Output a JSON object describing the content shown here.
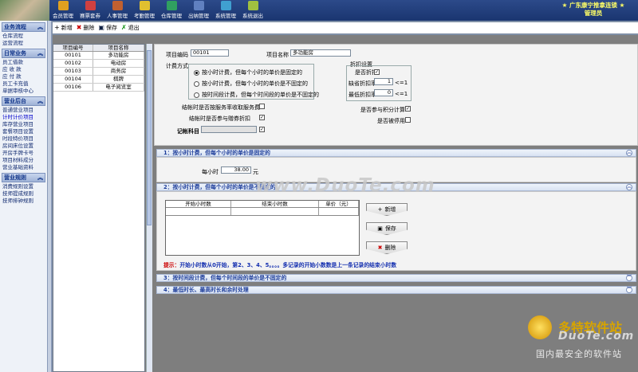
{
  "header": {
    "menu": [
      {
        "label": "会员管理",
        "icon": "member-icon",
        "color": "#e0a020"
      },
      {
        "label": "赛票套券",
        "icon": "ticket-icon",
        "color": "#d04040"
      },
      {
        "label": "人事管理",
        "icon": "person-icon",
        "color": "#c06030"
      },
      {
        "label": "考勤管理",
        "icon": "clock-icon",
        "color": "#e0c030"
      },
      {
        "label": "仓库管理",
        "icon": "warehouse-icon",
        "color": "#30a060"
      },
      {
        "label": "出纳管理",
        "icon": "cashier-icon",
        "color": "#6080c0"
      },
      {
        "label": "系统管理",
        "icon": "system-icon",
        "color": "#40a0d0"
      },
      {
        "label": "系统退出",
        "icon": "exit-icon",
        "color": "#a0c040"
      }
    ],
    "company_line1": "★ 广东康宁推拿连锁 ★",
    "company_line2": "管理员"
  },
  "sidebar": {
    "sections": [
      {
        "title": "业务流程",
        "items": [
          "仓库流程",
          "运营流程"
        ]
      },
      {
        "title": "日常业务",
        "items": [
          "员工借款",
          "应 收 款",
          "应 付 款",
          "员工卡充值",
          "单据审核中心"
        ]
      },
      {
        "title": "营业后台",
        "items": [
          "普通营业项目",
          "计时计价项目",
          "库存营业项目",
          "套餐项目设置",
          "时段特价项目",
          "房间床位设置",
          "开房手牌卡号",
          "项目材料成分",
          "营业基础资料"
        ]
      },
      {
        "title": "营业规则",
        "items": [
          "消费规则设置",
          "技师提成规则",
          "技师排钟规则"
        ]
      }
    ],
    "active_item": "计时计价项目"
  },
  "toolbar": {
    "new": "新增",
    "delete": "删除",
    "save": "保存",
    "exit": "退出"
  },
  "list": {
    "headers": [
      "项目编号",
      "项目名称"
    ],
    "rows": [
      [
        "00101",
        "多功能房"
      ],
      [
        "00102",
        "电动房"
      ],
      [
        "00103",
        "商务房"
      ],
      [
        "00104",
        "棋牌"
      ],
      [
        "00106",
        "电子阅览室"
      ]
    ]
  },
  "form": {
    "code_label": "项目编码",
    "code_value": "00101",
    "name_label": "项目名称",
    "name_value": "多功能房",
    "billing_label": "计费方式",
    "billing_options": [
      "按小时计费，但每个小时的单价是固定的",
      "按小时计费，但每个小时的单价是不固定的",
      "按时间段计费，但每个时间段的单价是不固定的"
    ],
    "discount_group": "折扣设置",
    "allow_discount_label": "是否折扣",
    "default_rate_label": "缺省折扣率",
    "default_rate_value": "1",
    "min_rate_label": "最低折扣率",
    "min_rate_value": "0",
    "rate_unit": "<=1",
    "points_label": "是否参与积分计算",
    "disabled_label": "是否被停用",
    "service_fee_label": "结帐时是否按服务率收取服务费",
    "participate_discount_label": "结帐时是否参与赠券折扣",
    "account_label": "记帐科目"
  },
  "panel1": {
    "title": "1：按小时计费，但每个小时的单价是固定的",
    "per_hour_label": "每小时",
    "per_hour_value": "38.00",
    "unit": "元"
  },
  "panel2": {
    "title": "2：按小时计费，但每个小时的单价是不固定的",
    "headers": [
      "开始小时数",
      "结束小时数",
      "单价（元）"
    ],
    "add": "新增",
    "save": "保存",
    "delete": "删除",
    "hint_prefix": "提示：",
    "hint_text": "开始小时数从0开始，第2、3、4、5。。。。多记录的开始小数数是上一条记录的结束小时数"
  },
  "panel3": {
    "title": "3：按时间段计费，但每个时间段的单价是不固定的"
  },
  "panel4": {
    "title": "4：最低时长、最高时长和余时处理"
  },
  "watermark": {
    "center": "www.DuoTe.com",
    "logo": "多特软件站",
    "url": "DuoTe.com",
    "slogan": "国内最安全的软件站"
  }
}
